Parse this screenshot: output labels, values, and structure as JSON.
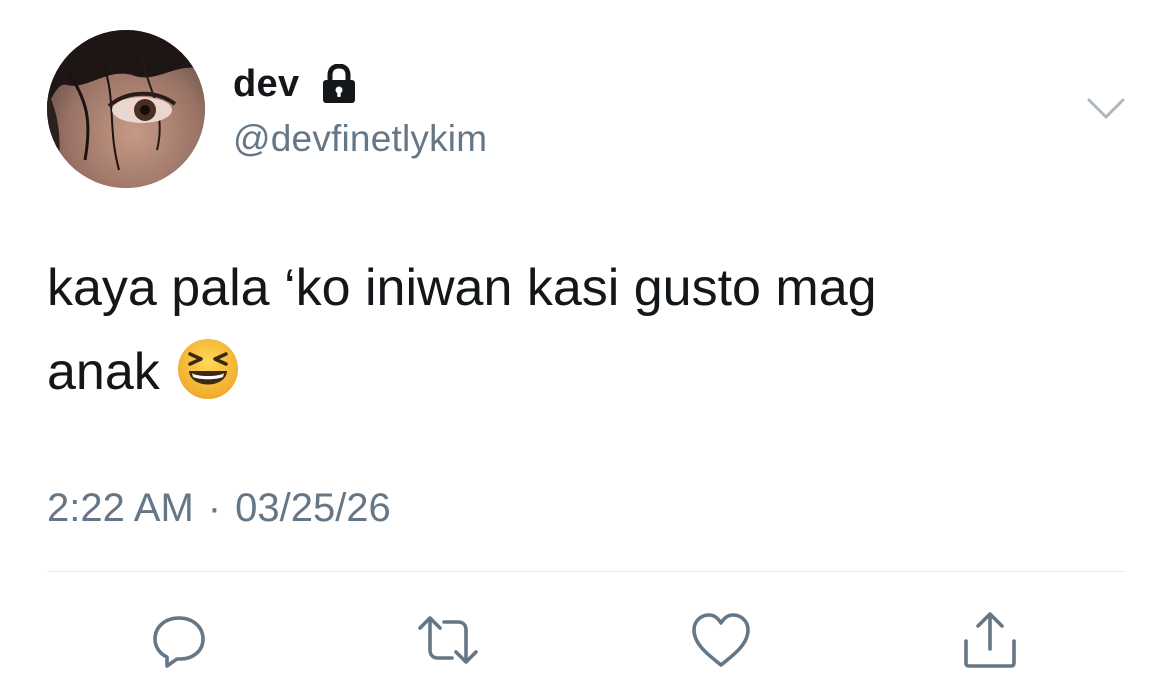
{
  "tweet": {
    "display_name": "dev",
    "handle": "@devfinetlykim",
    "text_line1": "kaya pala ‘ko iniwan kasi gusto mag",
    "text_line2": "anak",
    "emoji": "grinning-squinting-face",
    "time": "2:22 AM",
    "separator": "·",
    "date": "03/25/26",
    "protected": true
  },
  "icons": {
    "lock": "lock-icon",
    "caret": "chevron-down-icon",
    "reply": "reply-icon",
    "retweet": "retweet-icon",
    "like": "heart-icon",
    "share": "share-icon"
  },
  "colors": {
    "text": "#14171a",
    "secondary": "#657786",
    "divider": "#e1e8ed",
    "emoji_face": "#f7c23f"
  }
}
